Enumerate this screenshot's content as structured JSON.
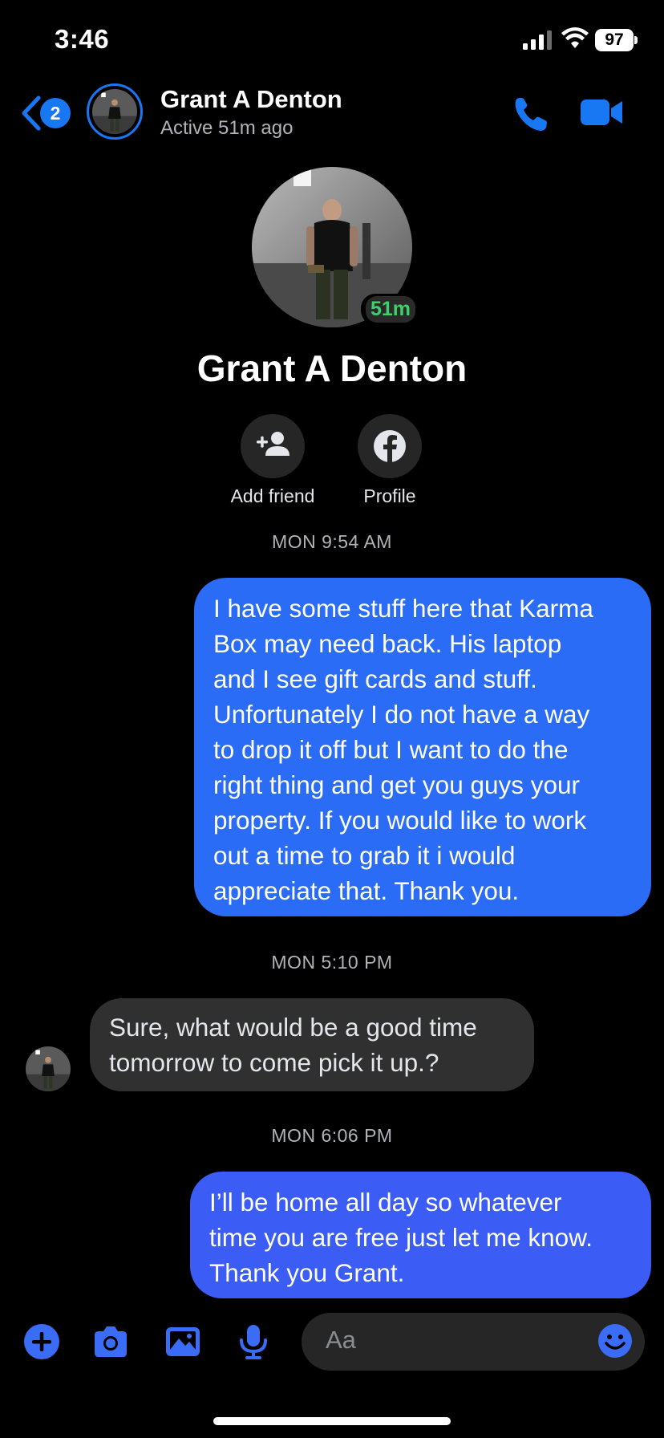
{
  "status_bar": {
    "time": "3:46",
    "battery": "97"
  },
  "header": {
    "back_badge_count": "2",
    "contact_name": "Grant A Denton",
    "active_status": "Active 51m ago"
  },
  "profile": {
    "name": "Grant A Denton",
    "active_badge": "51m",
    "actions": {
      "add_friend_label": "Add friend",
      "profile_label": "Profile"
    }
  },
  "conversation": {
    "timestamps": [
      "MON 9:54 AM",
      "MON 5:10 PM",
      "MON 6:06 PM"
    ],
    "messages": [
      {
        "sender": "me",
        "lines": [
          "I have some stuff here that Karma",
          "Box may need back. His laptop",
          "and I see gift cards and stuff.",
          "Unfortunately I do not have a way",
          "to drop it off but I want to do the",
          "right thing and get you guys your",
          "property. If you would like to work",
          "out a time to grab it i would",
          "appreciate that. Thank you."
        ]
      },
      {
        "sender": "contact",
        "lines": [
          "Sure, what would be a good time",
          "tomorrow to come pick it up.?"
        ]
      },
      {
        "sender": "me",
        "lines": [
          "I’ll be home all day so whatever",
          "time you are free just let me know.",
          "Thank you Grant."
        ]
      }
    ]
  },
  "composer": {
    "placeholder": "Aa"
  },
  "colors": {
    "accent": "#1877f2",
    "my_bubble_1": "#2a6cf6",
    "my_bubble_2": "#3b5cf5",
    "their_bubble": "#303030",
    "active_green": "#3dd16a"
  },
  "icons": [
    "back-chevron-icon",
    "phone-icon",
    "video-camera-icon",
    "add-friend-icon",
    "facebook-icon",
    "plus-circle-icon",
    "camera-icon",
    "image-icon",
    "microphone-icon",
    "emoji-icon"
  ]
}
